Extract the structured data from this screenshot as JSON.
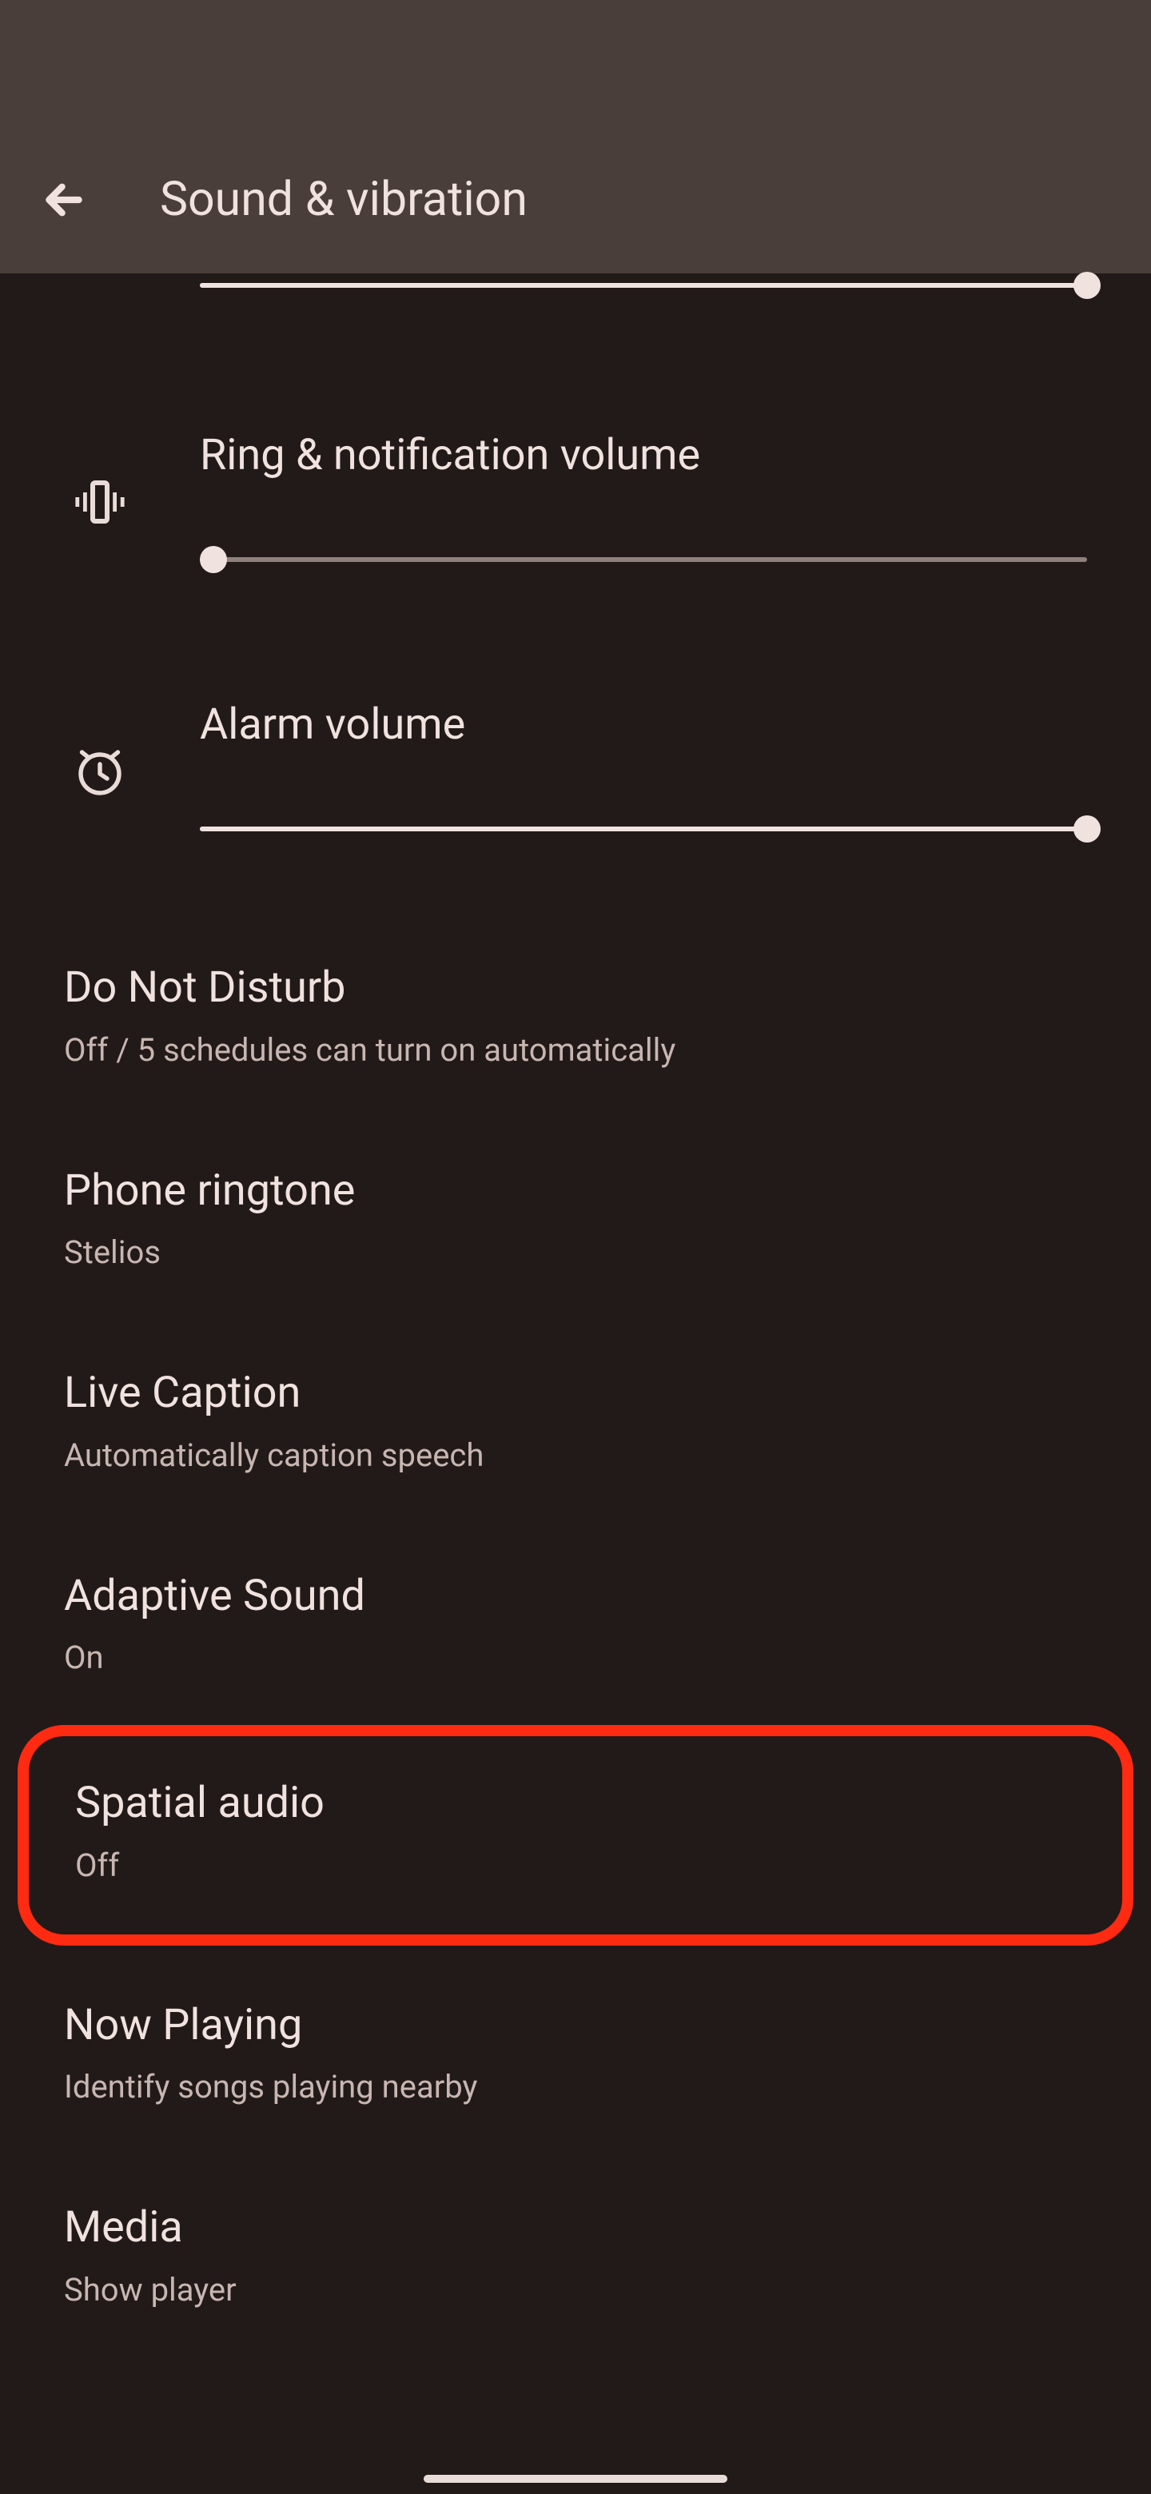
{
  "header": {
    "title": "Sound & vibration"
  },
  "topSlider": {
    "percent": 100
  },
  "sliders": [
    {
      "label": "Ring & notification volume",
      "icon": "vibrate-icon",
      "percent": 0
    },
    {
      "label": "Alarm volume",
      "icon": "alarm-icon",
      "percent": 100
    }
  ],
  "items": [
    {
      "title": "Do Not Disturb",
      "sub": "Off / 5 schedules can turn on automatically"
    },
    {
      "title": "Phone ringtone",
      "sub": "Stelios"
    },
    {
      "title": "Live Caption",
      "sub": "Automatically caption speech"
    },
    {
      "title": "Adaptive Sound",
      "sub": "On"
    },
    {
      "title": "Spatial audio",
      "sub": "Off",
      "highlighted": true
    },
    {
      "title": "Now Playing",
      "sub": "Identify songs playing nearby"
    },
    {
      "title": "Media",
      "sub": "Show player"
    }
  ]
}
